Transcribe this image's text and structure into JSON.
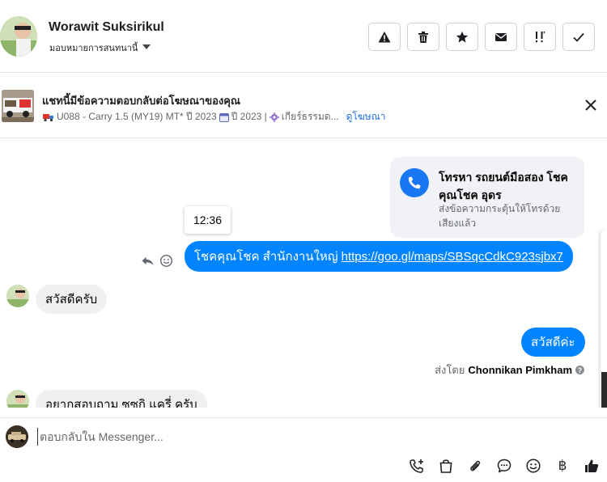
{
  "header": {
    "name": "Worawit Suksirikul",
    "assign_label": "มอบหมายการสนทนานี้",
    "actions": [
      {
        "icon": "warning-icon"
      },
      {
        "icon": "trash-icon"
      },
      {
        "icon": "star-icon"
      },
      {
        "icon": "mail-icon"
      },
      {
        "icon": "important-icon"
      },
      {
        "icon": "check-icon"
      }
    ]
  },
  "ad": {
    "title": "แชทนี้มีข้อความตอบกลับต่อโฆษณาของคุณ",
    "model": "U088 - Carry 1.5 (MY19) MT* ปี 2023",
    "year": "ปี 2023 |",
    "gear": "เกียร์ธรรมด...",
    "link": "ดูโฆษณา"
  },
  "thread": {
    "call_card": {
      "title": "โทรหา รถยนต์มือสอง โชคคุณโชค อุดร",
      "subtitle": "ส่งข้อความกระตุ้นให้โทรด้วยเสียงแล้ว"
    },
    "tooltip_time": "12:36",
    "msg_branch_text": "โชคคุณโชค สำนักงานใหญ่",
    "msg_branch_link": "https://goo.gl/maps/SBSqcCdkC923sjbx7",
    "msg_hello_customer": "สวัสดีครับ",
    "msg_hello_agent": "สวัสดีค่ะ",
    "sent_by_prefix": "ส่งโดย",
    "sent_by_name": "Chonnikan Pimkham",
    "msg_question": "อยากสอบถาม ซูซูกิ แครี่ ครับ"
  },
  "composer": {
    "placeholder": "ตอบกลับใน Messenger...",
    "currency_symbol": "฿"
  },
  "colors": {
    "accent": "#0084ff",
    "link": "#216fdb",
    "bubble_gray": "#f0f0f0"
  }
}
